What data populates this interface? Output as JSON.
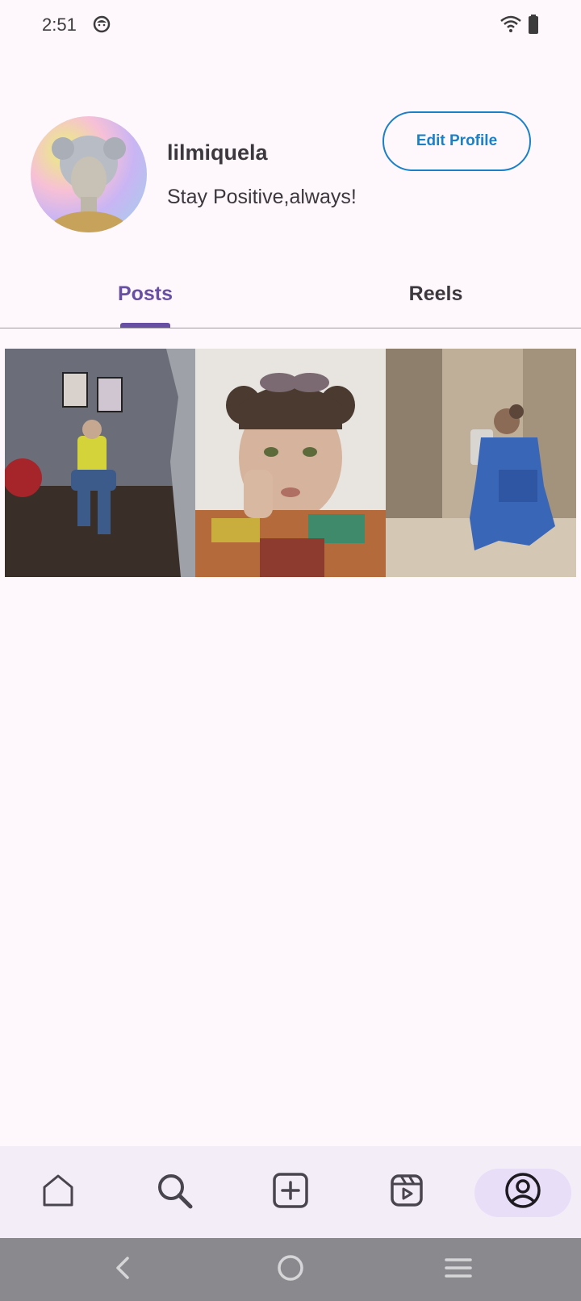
{
  "status": {
    "time": "2:51"
  },
  "profile": {
    "username": "lilmiquela",
    "bio": "Stay Positive,always!",
    "edit_button_label": "Edit Profile"
  },
  "tabs": [
    {
      "label": "Posts",
      "selected": true
    },
    {
      "label": "Reels",
      "selected": false
    }
  ],
  "posts": [
    {
      "description": "person sitting in yellow shirt"
    },
    {
      "description": "selfie with sunglasses on head"
    },
    {
      "description": "mirror selfie in denim outfit"
    }
  ],
  "bottom_nav": {
    "items": [
      {
        "icon": "home-icon"
      },
      {
        "icon": "search-icon"
      },
      {
        "icon": "add-post-icon"
      },
      {
        "icon": "reels-icon"
      },
      {
        "icon": "profile-icon",
        "selected": true
      }
    ]
  },
  "colors": {
    "accent": "#6750a4",
    "link": "#1a80c8",
    "background": "#fef7fc",
    "nav_background": "#f3edf7"
  }
}
